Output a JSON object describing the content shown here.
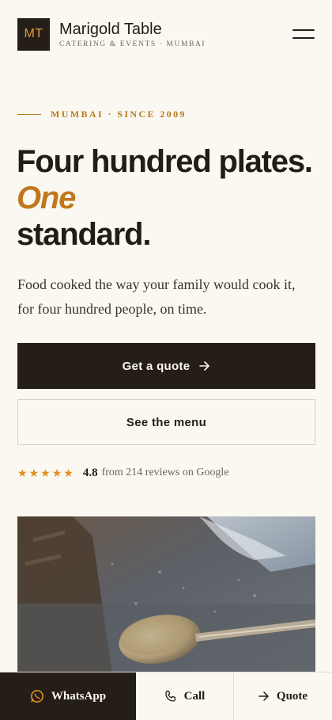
{
  "header": {
    "logo_initials": "MT",
    "brand_name": "Marigold Table",
    "brand_tagline": "CATERING & EVENTS · MUMBAI",
    "menu_icon": "hamburger-menu-icon"
  },
  "hero": {
    "eyebrow": "MUMBAI · SINCE 2009",
    "headline_part1": "Four hundred plates.",
    "headline_accent": "One",
    "headline_part2": "standard.",
    "subtext": "Food cooked the way your family would cook it, for four hundred people, on time.",
    "primary_button": "Get a quote",
    "primary_button_icon": "arrow-right-icon",
    "secondary_button": "See the menu"
  },
  "rating": {
    "stars": 5,
    "score": "4.8",
    "text": "from 214 reviews on Google"
  },
  "photo": {
    "description_icon": "photo-serving-spoons"
  },
  "bottom_bar": {
    "whatsapp_label": "WhatsApp",
    "call_label": "Call",
    "quote_label": "Quote"
  },
  "colors": {
    "background": "#fbf8f1",
    "dark": "#241d18",
    "accent": "#c0781c",
    "star": "#e0901e"
  }
}
